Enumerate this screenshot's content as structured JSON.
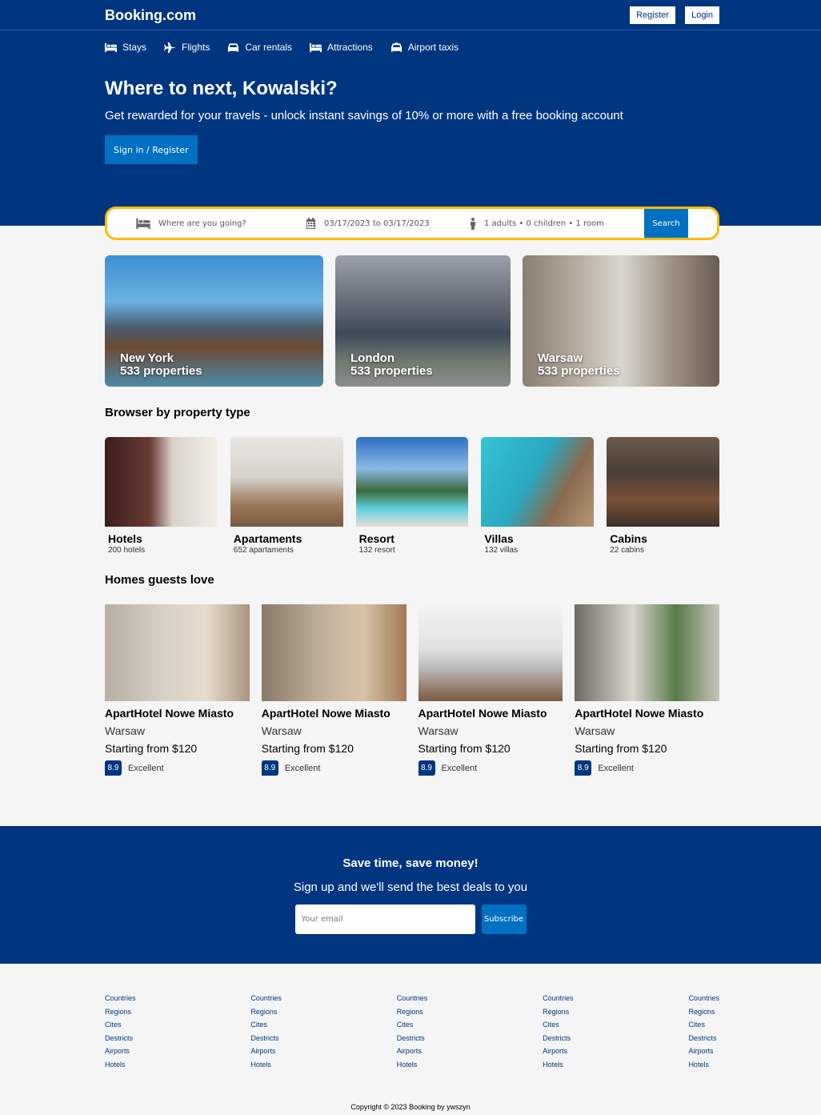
{
  "header": {
    "logo": "Booking.com",
    "register": "Register",
    "login": "Login",
    "nav": [
      {
        "label": "Stays",
        "icon": "bed-icon"
      },
      {
        "label": "Flights",
        "icon": "plane-icon"
      },
      {
        "label": "Car rentals",
        "icon": "car-icon"
      },
      {
        "label": "Attractions",
        "icon": "bed-icon"
      },
      {
        "label": "Airport taxis",
        "icon": "taxi-icon"
      }
    ],
    "title": "Where to next, Kowalski?",
    "subtitle": "Get rewarded for your travels - unlock instant savings of 10% or more with a free booking account",
    "cta": "Sign in / Register"
  },
  "search": {
    "destination_placeholder": "Where are you going?",
    "dates": "03/17/2023 to 03/17/2023",
    "guests": "1 adults • 0 children • 1 room",
    "button": "Search"
  },
  "featured": [
    {
      "city": "New York",
      "count": "533 properties"
    },
    {
      "city": "London",
      "count": "533 properties"
    },
    {
      "city": "Warsaw",
      "count": "533 properties"
    }
  ],
  "property_types": {
    "title": "Browser by property type",
    "items": [
      {
        "name": "Hotels",
        "count": "200 hotels"
      },
      {
        "name": "Apartaments",
        "count": "652 apartaments"
      },
      {
        "name": "Resort",
        "count": "132 resort"
      },
      {
        "name": "Villas",
        "count": "132 villas"
      },
      {
        "name": "Cabins",
        "count": "22 cabins"
      }
    ]
  },
  "homes": {
    "title": "Homes guests love",
    "items": [
      {
        "name": "ApartHotel Nowe Miasto",
        "city": "Warsaw",
        "price": "Starting from $120",
        "score": "8.9",
        "rating": "Excellent"
      },
      {
        "name": "ApartHotel Nowe Miasto",
        "city": "Warsaw",
        "price": "Starting from $120",
        "score": "8.9",
        "rating": "Excellent"
      },
      {
        "name": "ApartHotel Nowe Miasto",
        "city": "Warsaw",
        "price": "Starting from $120",
        "score": "8.9",
        "rating": "Excellent"
      },
      {
        "name": "ApartHotel Nowe Miasto",
        "city": "Warsaw",
        "price": "Starting from $120",
        "score": "8.9",
        "rating": "Excellent"
      }
    ]
  },
  "newsletter": {
    "title": "Save time, save money!",
    "subtitle": "Sign up and we'll send the best deals to you",
    "email_placeholder": "Your email",
    "button": "Subscribe"
  },
  "footer": {
    "columns": [
      [
        "Countries",
        "Regions",
        "Cites",
        "Destricts",
        "Airports",
        "Hotels"
      ],
      [
        "Countries",
        "Regions",
        "Cites",
        "Destricts",
        "Airports",
        "Hotels"
      ],
      [
        "Countries",
        "Regions",
        "Cites",
        "Destricts",
        "Airports",
        "Hotels"
      ],
      [
        "Countries",
        "Regions",
        "Cites",
        "Destricts",
        "Airports",
        "Hotels"
      ],
      [
        "Countries",
        "Regions",
        "Cites",
        "Destricts",
        "Airports",
        "Hotels"
      ]
    ],
    "copyright": "Copyright © 2023 Booking by ywszyn"
  },
  "colors": {
    "brand": "#003580",
    "accent": "#0071c2",
    "search_border": "#febb02"
  }
}
